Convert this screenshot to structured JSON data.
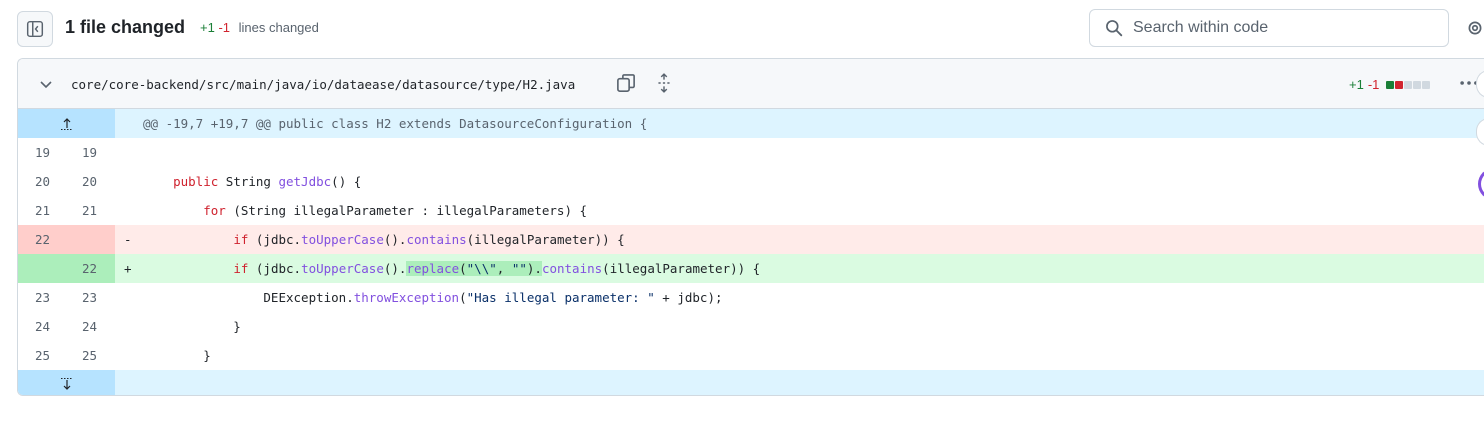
{
  "header": {
    "files_changed": "1 file changed",
    "additions": "+1",
    "deletions": "-1",
    "lines_changed_label": "lines changed"
  },
  "search": {
    "placeholder": "Search within code"
  },
  "icons": {
    "sidebar_toggle": "sidebar-toggle-icon",
    "search": "search-icon",
    "gear": "gear-icon",
    "chevron": "chevron-down-icon",
    "copy": "copy-icon",
    "expand": "unfold-icon",
    "more": "kebab-horizontal-icon",
    "expand_up": "expand-up-icon",
    "expand_down": "expand-down-icon"
  },
  "file": {
    "path": "core/core-backend/src/main/java/io/dataease/datasource/type/H2.java",
    "additions": "+1",
    "deletions": "-1",
    "hunk_header": "@@ -19,7 +19,7 @@ public class H2 extends DatasourceConfiguration {"
  },
  "diff_lines": [
    {
      "old": "19",
      "new": "19",
      "marker": "",
      "code": ""
    },
    {
      "old": "20",
      "new": "20",
      "marker": "",
      "code": "public String getJdbc() {"
    },
    {
      "old": "21",
      "new": "21",
      "marker": "",
      "code": "for (String illegalParameter : illegalParameters) {"
    },
    {
      "old": "22",
      "new": "",
      "marker": "-",
      "code": "if (jdbc.toUpperCase().contains(illegalParameter)) {"
    },
    {
      "old": "",
      "new": "22",
      "marker": "+",
      "code": "if (jdbc.toUpperCase().replace(\"\\\\\", \"\").contains(illegalParameter)) {"
    },
    {
      "old": "23",
      "new": "23",
      "marker": "",
      "code": "DEException.throwException(\"Has illegal parameter: \" + jdbc);"
    },
    {
      "old": "24",
      "new": "24",
      "marker": "",
      "code": "}"
    },
    {
      "old": "25",
      "new": "25",
      "marker": "",
      "code": "}"
    }
  ],
  "colors": {
    "addition": "#1a7f37",
    "deletion": "#d1242f",
    "hunk_bg": "#ddf4ff",
    "del_bg": "#ffebe9",
    "add_bg": "#dafbe1"
  }
}
